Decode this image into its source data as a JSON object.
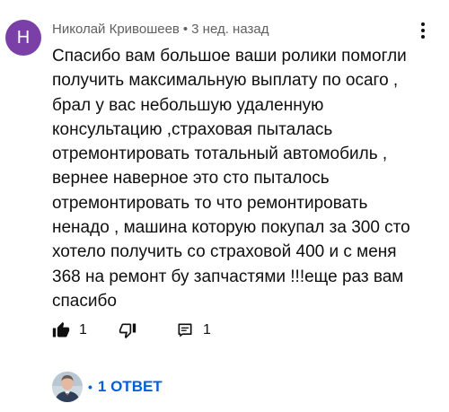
{
  "comment": {
    "avatar_letter": "Н",
    "avatar_color": "#7b3fa8",
    "author": "Николай Кривошеев",
    "separator": "•",
    "time": "3 нед. назад",
    "menu_icon": "more-vert-icon",
    "text": "Спасибо вам большое ваши ролики помогли получить максимальную выплату по осаго , брал у вас небольшую удаленную консультацию ,страховая пыталась отремонтировать тотальный автомобиль , вернее наверное это сто пыталось отремонтировать то что ремонтировать ненадо , машина которую покупал за 300 сто хотело получить со страховой 400 и с меня 368 на ремонт бу запчастями !!!еще раз вам спасибо"
  },
  "actions": {
    "like_icon": "thumb-up-icon",
    "like_count": "1",
    "dislike_icon": "thumb-down-icon",
    "reply_icon": "reply-comment-icon",
    "reply_count": "1"
  },
  "replies": {
    "bullet": "•",
    "label": "1 ОТВЕТ",
    "link_color": "#065fd4"
  }
}
